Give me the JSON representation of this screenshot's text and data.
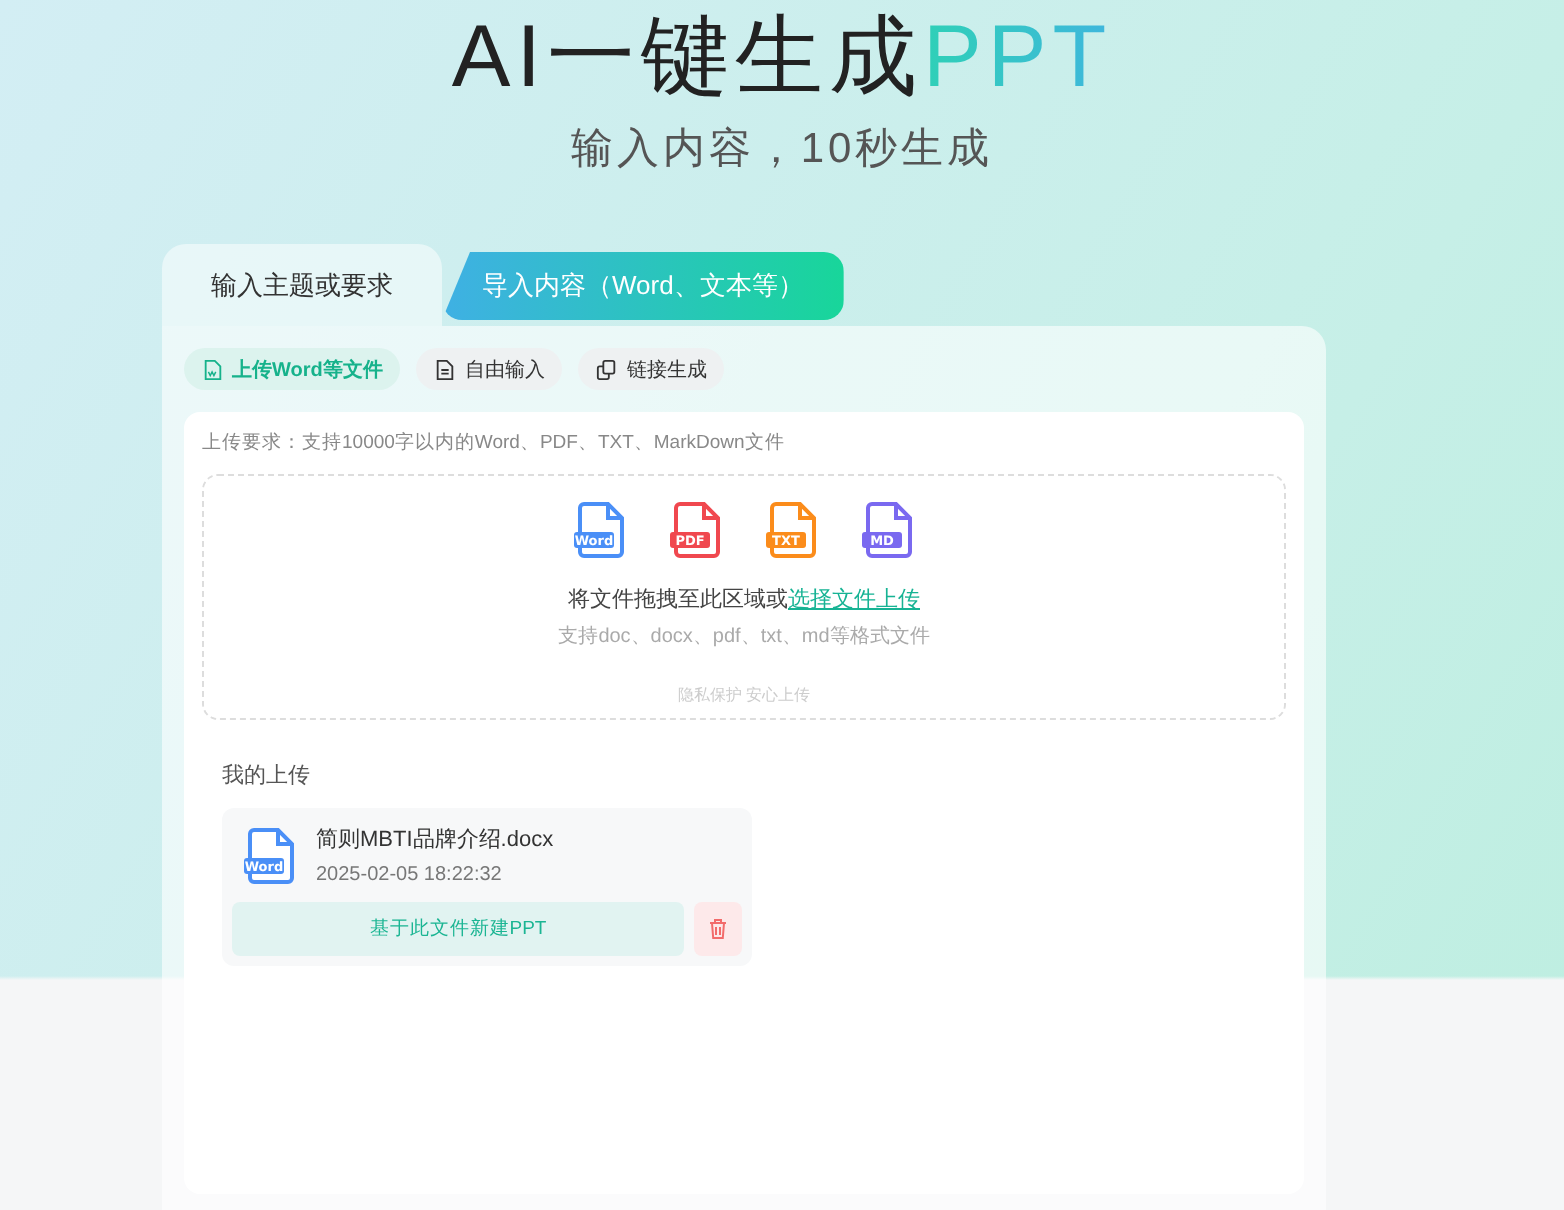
{
  "hero": {
    "title": "AI一键生成",
    "title_highlight": "PPT",
    "subtitle": "输入内容，10秒生成"
  },
  "tabs": [
    {
      "label": "输入主题或要求",
      "selected": false
    },
    {
      "label": "导入内容（Word、文本等）",
      "selected": true
    }
  ],
  "modes": [
    {
      "label": "上传Word等文件",
      "kind": "upload",
      "selected": true
    },
    {
      "label": "自由输入",
      "kind": "text",
      "selected": false
    },
    {
      "label": "链接生成",
      "kind": "link",
      "selected": false
    }
  ],
  "requirement": "上传要求：支持10000字以内的Word、PDF、TXT、MarkDown文件",
  "dropzone": {
    "file_types": [
      {
        "label": "Word",
        "color": "#4a8ff7"
      },
      {
        "label": "PDF",
        "color": "#f0484f"
      },
      {
        "label": "TXT",
        "color": "#fb8c1b"
      },
      {
        "label": "MD",
        "color": "#7a69f0"
      }
    ],
    "prompt": "将文件拖拽至此区域或",
    "link": "选择文件上传",
    "formats": "支持doc、docx、pdf、txt、md等格式文件",
    "privacy": "隐私保护 安心上传"
  },
  "uploads": {
    "title": "我的上传",
    "items": [
      {
        "badge": "Word",
        "name": "简则MBTI品牌介绍.docx",
        "time": "2025-02-05 18:22:32",
        "action": "基于此文件新建PPT"
      }
    ]
  }
}
